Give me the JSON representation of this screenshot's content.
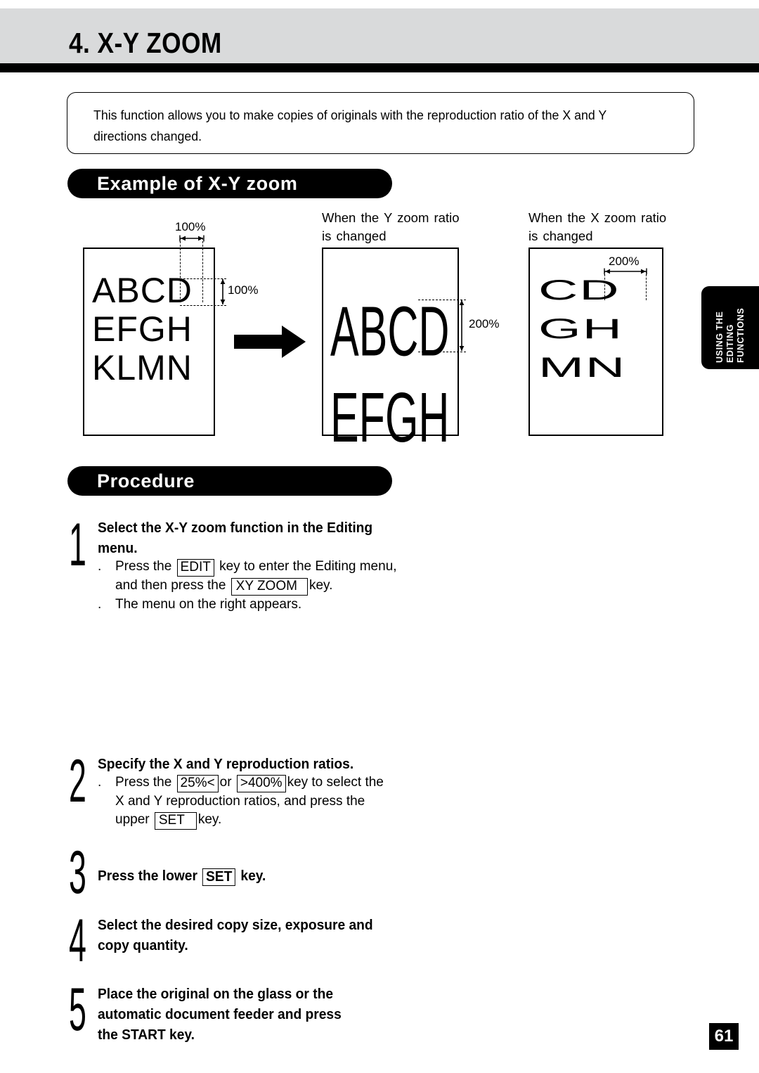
{
  "header": {
    "title": "4. X-Y ZOOM"
  },
  "intro": {
    "text": "This function allows you to make copies of originals with the reproduction ratio of the X and Y directions changed."
  },
  "sections": {
    "example_heading": "Example of X-Y zoom",
    "procedure_heading": "Procedure"
  },
  "example": {
    "captions": {
      "y_changed": "When the Y zoom ratio\nis changed",
      "x_changed": "When the X zoom ratio\nis changed"
    },
    "panels": {
      "original": {
        "name": "original-document",
        "letters": "ABCD\nEFGH\nKLMN",
        "dim_x": "100%",
        "dim_y": "100%"
      },
      "y_zoomed": {
        "name": "y-zoom-result",
        "letters": "ABCD\nEFGH",
        "dim_y": "200%"
      },
      "x_zoomed": {
        "name": "x-zoom-result",
        "letters": "CD\nGH\nMN",
        "dim_x": "200%"
      }
    },
    "arrow_icon": "right-arrow-icon"
  },
  "procedure": {
    "steps": [
      {
        "number": "1",
        "heading": "Select the X-Y zoom function in the Editing\nmenu.",
        "bullets": [
          {
            "marker": ".",
            "parts": [
              {
                "type": "text",
                "value": "Press the "
              },
              {
                "type": "key",
                "value": "EDIT"
              },
              {
                "type": "text",
                "value": " key to enter the Editing menu,"
              }
            ],
            "line2_parts": [
              {
                "type": "text",
                "value": "and then press the  "
              },
              {
                "type": "key",
                "value": "XY ZOOM"
              },
              {
                "type": "text",
                "value": "key."
              }
            ]
          },
          {
            "marker": ".",
            "text": "The menu on the right appears."
          }
        ]
      },
      {
        "number": "2",
        "heading": "Specify the X and Y reproduction ratios.",
        "bullets": [
          {
            "marker": ".",
            "line1_pre": "Press the ",
            "key1": "25%<",
            "line1_mid": "or ",
            "key2": ">400%",
            "line1_post": "key to select the",
            "line2": "X and Y reproduction ratios, and press the",
            "line3_pre": "upper  ",
            "key3": "SET",
            "line3_post": "key."
          }
        ]
      },
      {
        "number": "3",
        "heading_pre": "Press the lower  ",
        "heading_key": "SET",
        "heading_post": "  key."
      },
      {
        "number": "4",
        "heading": "Select the desired copy size, exposure and\ncopy quantity."
      },
      {
        "number": "5",
        "heading": "Place the original on the glass or the\nautomatic document  feeder  and  press\nthe  START key."
      }
    ]
  },
  "side_tab": {
    "line1": "USING THE",
    "line2": "EDITING",
    "line3": "FUNCTIONS"
  },
  "page_number": "61",
  "colors": {
    "header_band": "#d9dadb",
    "ink": "#000000",
    "paper": "#ffffff"
  }
}
